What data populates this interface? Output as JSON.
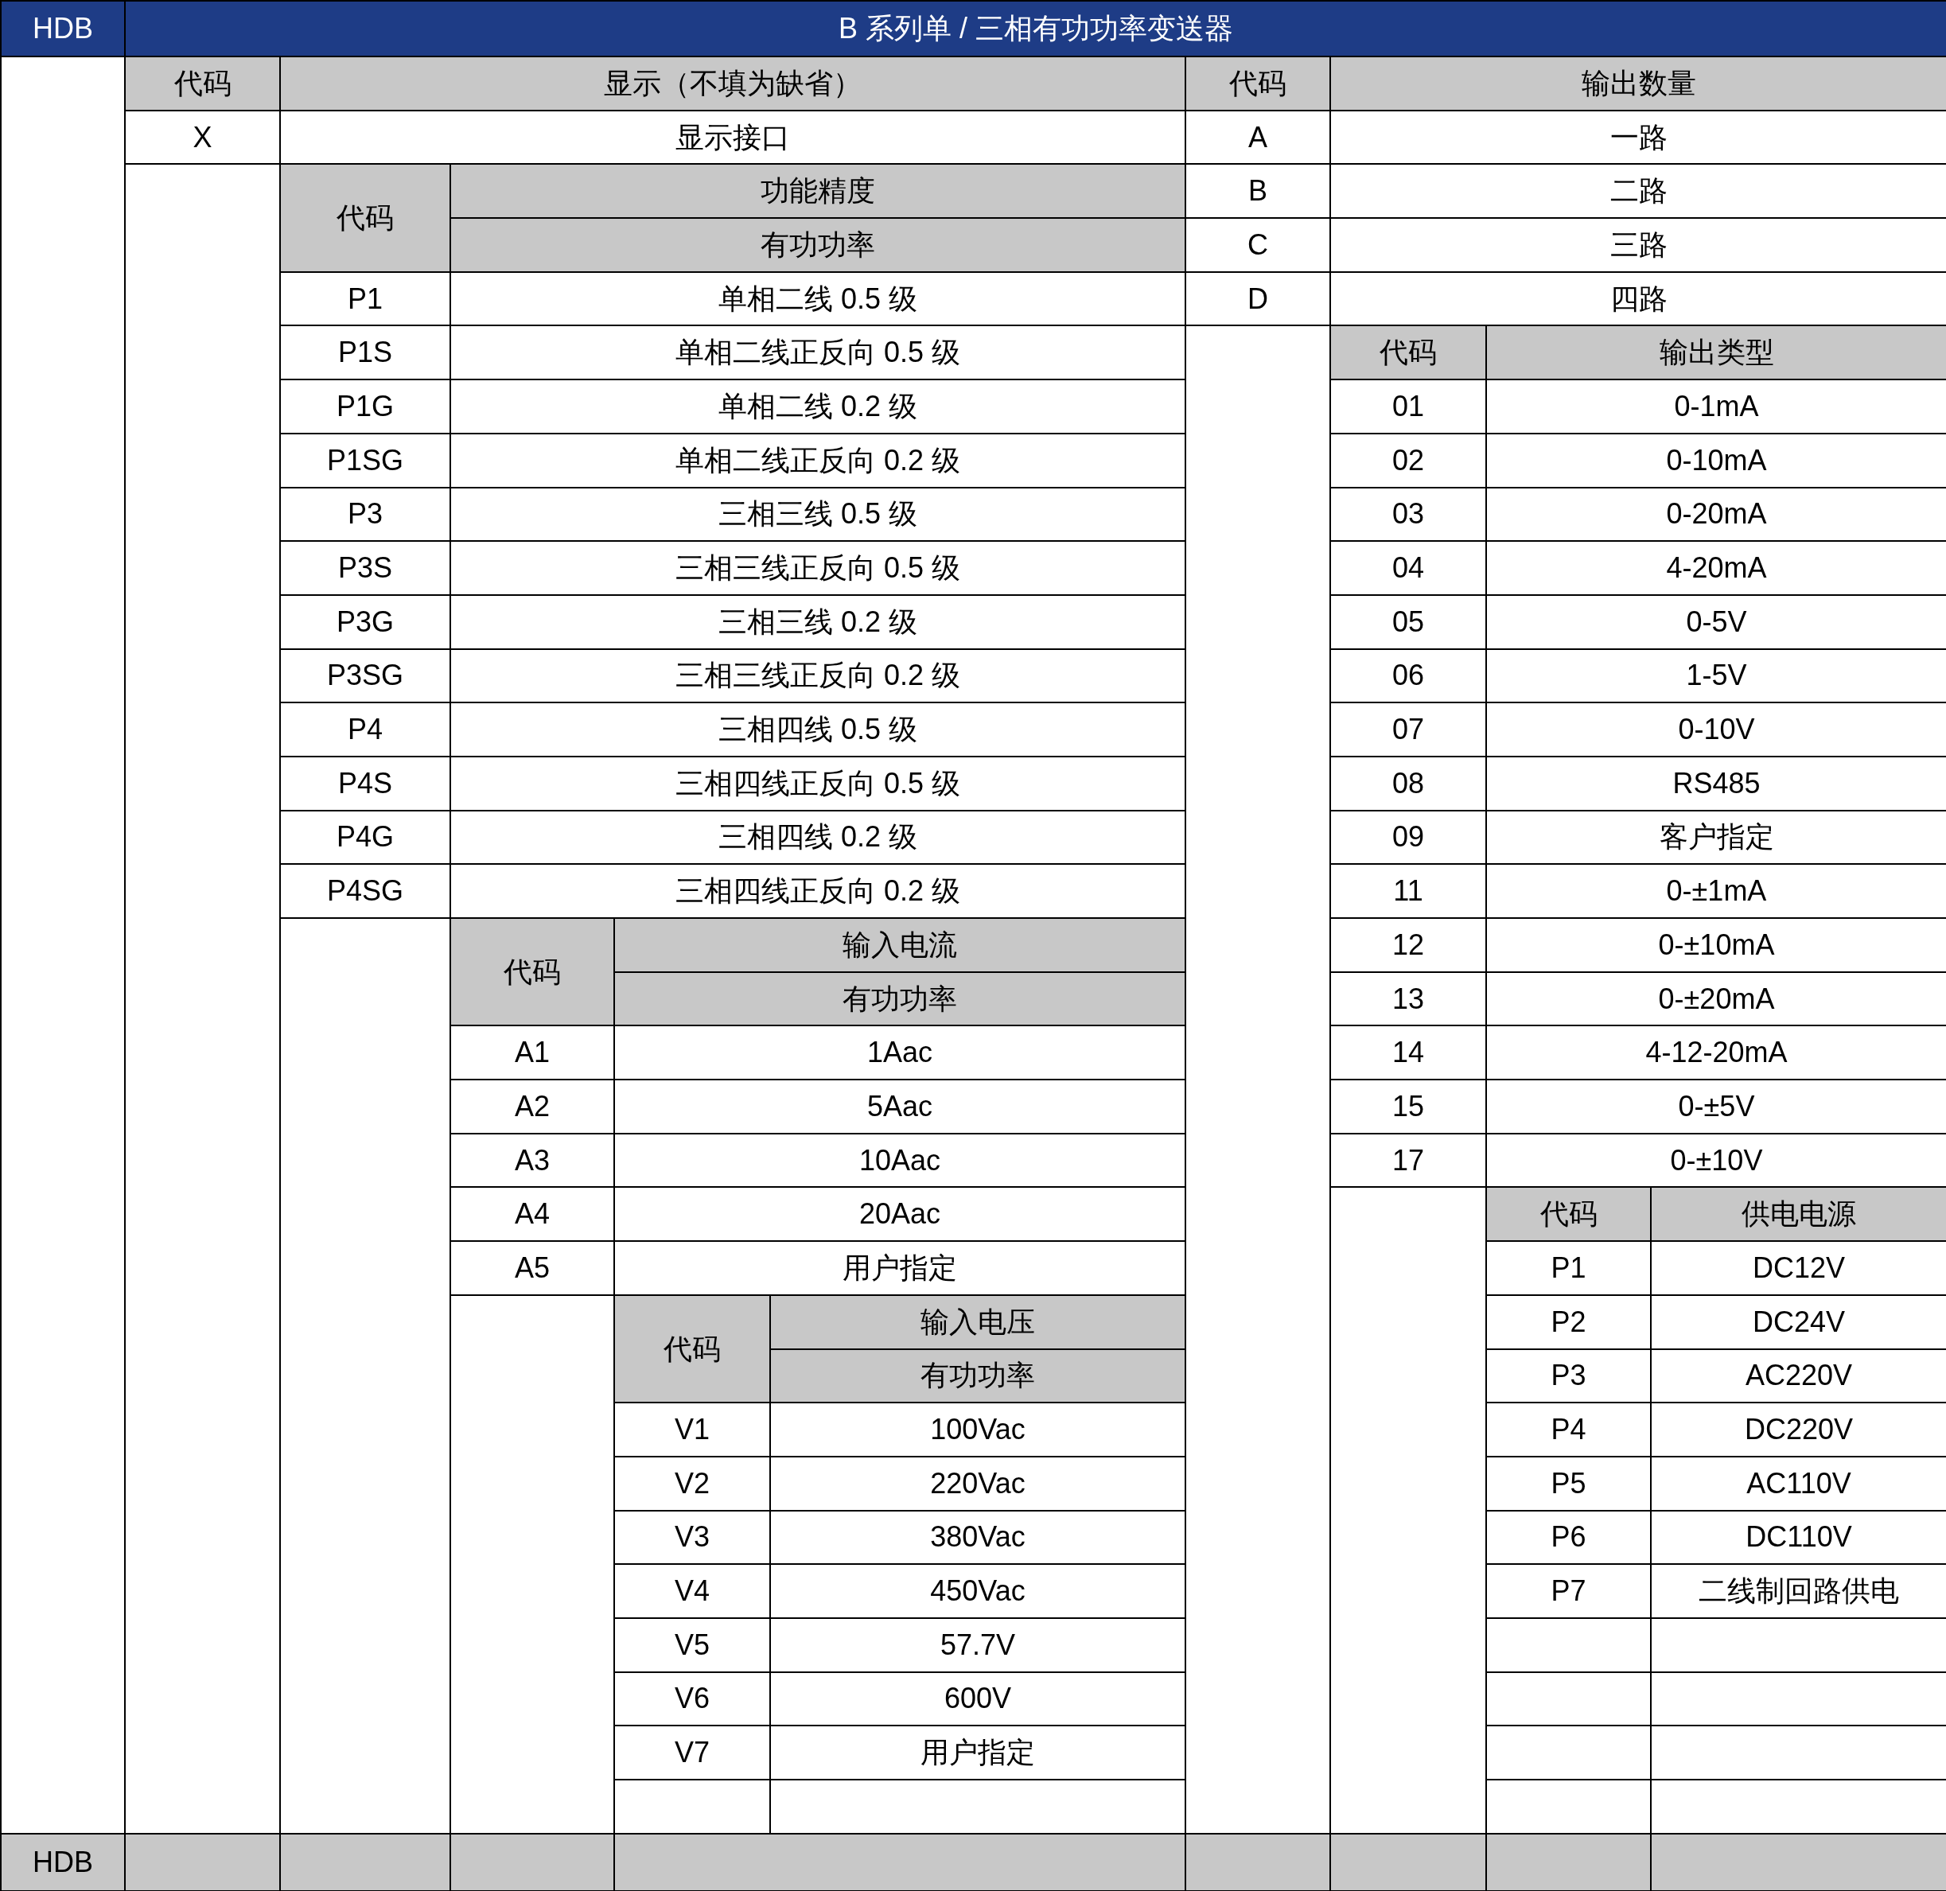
{
  "title_bar": {
    "brand": "HDB",
    "title": "B 系列单 / 三相有功功率变送器"
  },
  "left_sections": [
    {
      "code_header": "代码",
      "headers": [
        "显示（不填为缺省）"
      ],
      "rows": [
        {
          "code": "X",
          "label": "显示接口"
        }
      ]
    },
    {
      "code_header": "代码",
      "headers": [
        "功能精度",
        "有功功率"
      ],
      "rows": [
        {
          "code": "P1",
          "label": "单相二线 0.5 级"
        },
        {
          "code": "P1S",
          "label": "单相二线正反向 0.5 级"
        },
        {
          "code": "P1G",
          "label": "单相二线 0.2 级"
        },
        {
          "code": "P1SG",
          "label": "单相二线正反向 0.2 级"
        },
        {
          "code": "P3",
          "label": "三相三线 0.5 级"
        },
        {
          "code": "P3S",
          "label": "三相三线正反向 0.5 级"
        },
        {
          "code": "P3G",
          "label": "三相三线 0.2 级"
        },
        {
          "code": "P3SG",
          "label": "三相三线正反向 0.2 级"
        },
        {
          "code": "P4",
          "label": "三相四线 0.5 级"
        },
        {
          "code": "P4S",
          "label": "三相四线正反向 0.5 级"
        },
        {
          "code": "P4G",
          "label": "三相四线 0.2 级"
        },
        {
          "code": "P4SG",
          "label": "三相四线正反向 0.2 级"
        }
      ]
    },
    {
      "code_header": "代码",
      "headers": [
        "输入电流",
        "有功功率"
      ],
      "rows": [
        {
          "code": "A1",
          "label": "1Aac"
        },
        {
          "code": "A2",
          "label": "5Aac"
        },
        {
          "code": "A3",
          "label": "10Aac"
        },
        {
          "code": "A4",
          "label": "20Aac"
        },
        {
          "code": "A5",
          "label": "用户指定"
        }
      ]
    },
    {
      "code_header": "代码",
      "headers": [
        "输入电压",
        "有功功率"
      ],
      "rows": [
        {
          "code": "V1",
          "label": "100Vac"
        },
        {
          "code": "V2",
          "label": "220Vac"
        },
        {
          "code": "V3",
          "label": "380Vac"
        },
        {
          "code": "V4",
          "label": "450Vac"
        },
        {
          "code": "V5",
          "label": "57.7V"
        },
        {
          "code": "V6",
          "label": "600V"
        },
        {
          "code": "V7",
          "label": "用户指定"
        }
      ]
    }
  ],
  "right_sections": [
    {
      "code_header": "代码",
      "headers": [
        "输出数量"
      ],
      "rows": [
        {
          "code": "A",
          "label": "一路"
        },
        {
          "code": "B",
          "label": "二路"
        },
        {
          "code": "C",
          "label": "三路"
        },
        {
          "code": "D",
          "label": "四路"
        }
      ]
    },
    {
      "code_header": "代码",
      "headers": [
        "输出类型"
      ],
      "rows": [
        {
          "code": "01",
          "label": "0-1mA"
        },
        {
          "code": "02",
          "label": "0-10mA"
        },
        {
          "code": "03",
          "label": "0-20mA"
        },
        {
          "code": "04",
          "label": "4-20mA"
        },
        {
          "code": "05",
          "label": "0-5V"
        },
        {
          "code": "06",
          "label": "1-5V"
        },
        {
          "code": "07",
          "label": "0-10V"
        },
        {
          "code": "08",
          "label": "RS485"
        },
        {
          "code": "09",
          "label": "客户指定"
        },
        {
          "code": "11",
          "label": "0-±1mA"
        },
        {
          "code": "12",
          "label": "0-±10mA"
        },
        {
          "code": "13",
          "label": "0-±20mA"
        },
        {
          "code": "14",
          "label": "4-12-20mA"
        },
        {
          "code": "15",
          "label": "0-±5V"
        },
        {
          "code": "17",
          "label": "0-±10V"
        }
      ]
    },
    {
      "code_header": "代码",
      "headers": [
        "供电电源"
      ],
      "rows": [
        {
          "code": "P1",
          "label": "DC12V"
        },
        {
          "code": "P2",
          "label": "DC24V"
        },
        {
          "code": "P3",
          "label": "AC220V"
        },
        {
          "code": "P4",
          "label": "DC220V"
        },
        {
          "code": "P5",
          "label": "AC110V"
        },
        {
          "code": "P6",
          "label": "DC110V"
        },
        {
          "code": "P7",
          "label": "二线制回路供电"
        }
      ]
    }
  ],
  "footer": {
    "brand": "HDB"
  }
}
